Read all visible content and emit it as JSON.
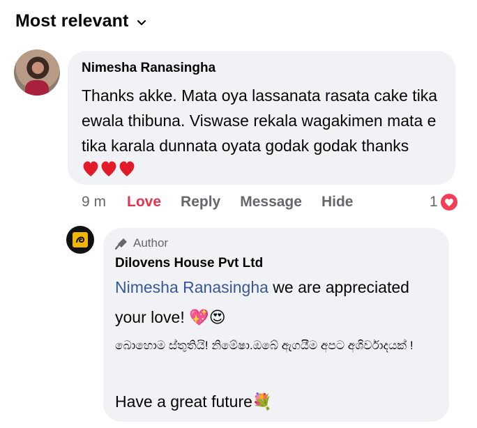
{
  "sort": {
    "label": "Most relevant",
    "icon": "chevron-down-icon"
  },
  "comment": {
    "author": "Nimesha Ranasingha",
    "text": "Thanks akke. Mata oya lassanata rasata   cake tika ewala thibuna. Viswase rekala wagakimen mata e tika karala dunnata oyata godak godak thanks",
    "emoji": "❤❤❤",
    "time": "9 m",
    "actions": {
      "love": "Love",
      "reply": "Reply",
      "message": "Message",
      "hide": "Hide"
    },
    "reaction_count": "1",
    "reaction_icon": "love-reaction-icon",
    "colors": {
      "love": "#e4344d",
      "reaction": "#f33e58"
    }
  },
  "reply": {
    "badge": "Author",
    "author": "Dilovens House Pvt Ltd",
    "mention": "Nimesha Ranasingha",
    "text": " we are appreciated your love! ",
    "emoji": "💖😍",
    "sinhala": "බොහොම ස්තුතියි! නිමේෂා.ඔබේ ඇගයීම අපට අශිර්වාදයක් !",
    "closing": "Have a great future",
    "closing_emoji": "💐",
    "colors": {
      "mention": "#385898"
    }
  }
}
